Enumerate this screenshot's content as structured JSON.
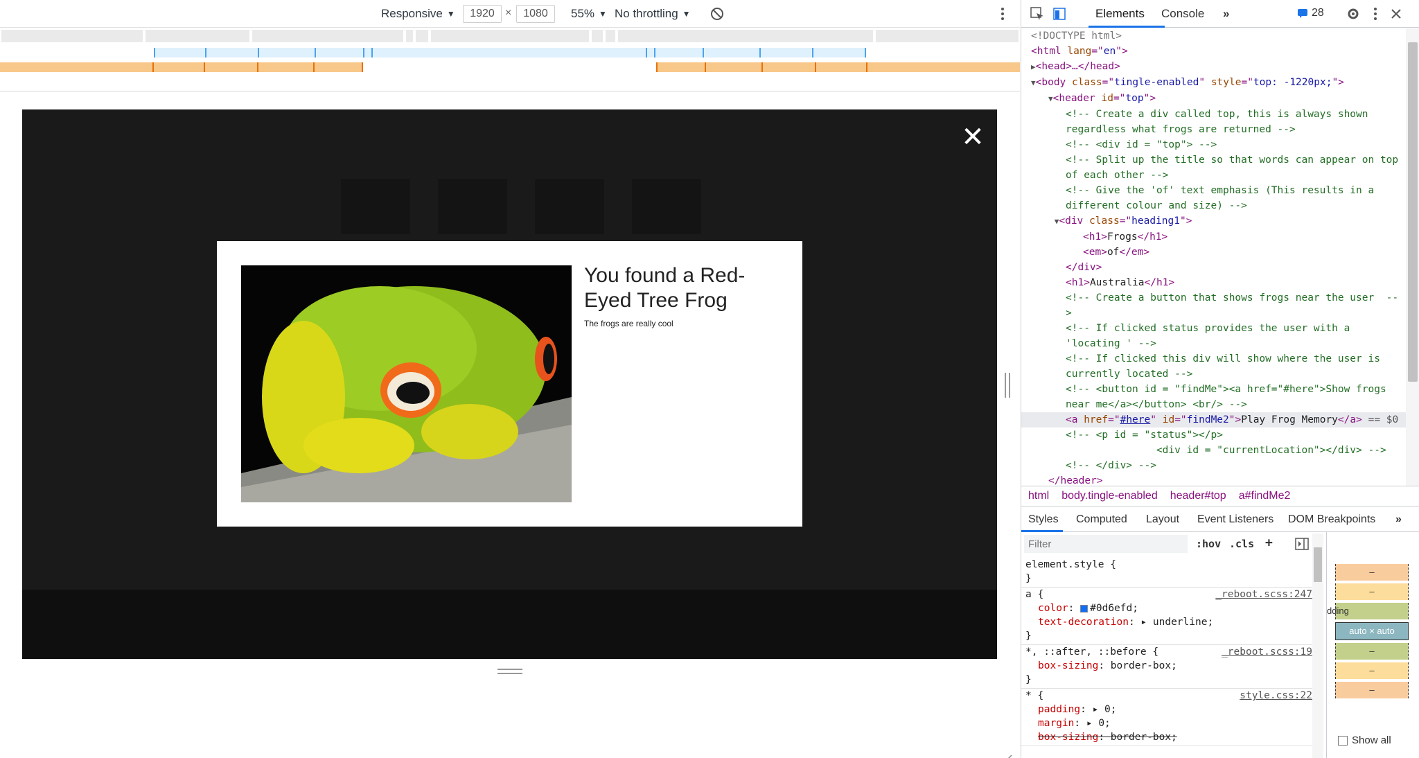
{
  "device_toolbar": {
    "device": "Responsive",
    "width": "1920",
    "height": "1080",
    "times": "×",
    "zoom": "55%",
    "throttling": "No throttling"
  },
  "page": {
    "close_symbol": "✕",
    "modal_title": "You found a Red-Eyed Tree Frog",
    "modal_subtitle": "The frogs are really cool"
  },
  "devtools": {
    "tabs": [
      "Elements",
      "Console"
    ],
    "more_tabs": "»",
    "issues_count": "28",
    "dom_lines": [
      {
        "indent": 0,
        "html": "<span class='cm' style='color:#777'>&lt;!DOCTYPE html&gt;</span>"
      },
      {
        "indent": 0,
        "html": "&lt;<span class='tg'>html</span> <span class='an'>lang</span>=\"<span class='av'>en</span>\"&gt;"
      },
      {
        "indent": 0,
        "html": "<span class='tri'>▶</span>&lt;<span class='tg'>head</span>&gt;…&lt;/<span class='tg'>head</span>&gt;"
      },
      {
        "indent": 0,
        "html": "<span class='tri'>▼</span>&lt;<span class='tg'>body</span> <span class='an'>class</span>=\"<span class='av'>tingle-enabled</span>\" <span class='an'>style</span>=\"<span class='av'>top: -1220px;</span>\"&gt;"
      },
      {
        "indent": 1,
        "html": "<span class='tri'>▼</span>&lt;<span class='tg'>header</span> <span class='an'>id</span>=\"<span class='av'>top</span>\"&gt;"
      },
      {
        "indent": 2,
        "html": "<span class='cm'>&lt;!-- Create a div called top, this is always shown</span>"
      },
      {
        "indent": 2,
        "html": "<span class='cm'>regardless what frogs are returned --&gt;</span>"
      },
      {
        "indent": 2,
        "html": "<span class='cm'>&lt;!-- &lt;div id = \"top\"&gt; --&gt;</span>"
      },
      {
        "indent": 2,
        "html": "<span class='cm'>&lt;!-- Split up the title so that words can appear on top</span>"
      },
      {
        "indent": 2,
        "html": "<span class='cm'>of each other --&gt;</span>"
      },
      {
        "indent": 2,
        "html": "<span class='cm'>&lt;!-- Give the 'of' text emphasis (This results in a</span>"
      },
      {
        "indent": 2,
        "html": "<span class='cm'>different colour and size) --&gt;</span>"
      },
      {
        "indent": 1,
        "html": " <span class='tri'>▼</span>&lt;<span class='tg'>div</span> <span class='an'>class</span>=\"<span class='av'>heading1</span>\"&gt;"
      },
      {
        "indent": 3,
        "html": "&lt;<span class='tg'>h1</span>&gt;<span class='tx'>Frogs</span>&lt;/<span class='tg'>h1</span>&gt;"
      },
      {
        "indent": 3,
        "html": "&lt;<span class='tg'>em</span>&gt;<span class='tx'>of</span>&lt;/<span class='tg'>em</span>&gt;"
      },
      {
        "indent": 2,
        "html": "&lt;/<span class='tg'>div</span>&gt;"
      },
      {
        "indent": 2,
        "html": "&lt;<span class='tg'>h1</span>&gt;<span class='tx'>Australia</span>&lt;/<span class='tg'>h1</span>&gt;"
      },
      {
        "indent": 2,
        "html": "<span class='cm'>&lt;!-- Create a button that shows frogs near the user  --</span>"
      },
      {
        "indent": 2,
        "html": "<span class='cm'>&gt;</span>"
      },
      {
        "indent": 2,
        "html": "<span class='cm'>&lt;!-- If clicked status provides the user with a</span>"
      },
      {
        "indent": 2,
        "html": "<span class='cm'>'locating ' --&gt;</span>"
      },
      {
        "indent": 2,
        "html": "<span class='cm'>&lt;!-- If clicked this div will show where the user is</span>"
      },
      {
        "indent": 2,
        "html": "<span class='cm'>currently located --&gt;</span>"
      },
      {
        "indent": 2,
        "html": "<span class='cm'>&lt;!-- &lt;button id = \"findMe\"&gt;&lt;a href=\"#here\"&gt;Show frogs</span>"
      },
      {
        "indent": 2,
        "html": "<span class='cm'>near me&lt;/a&gt;&lt;/button&gt; &lt;br/&gt; --&gt;</span>"
      },
      {
        "indent": 2,
        "sel": true,
        "html": "&lt;<span class='tg'>a</span> <span class='an'>href</span>=\"<span class='av' style='text-decoration:underline'>#here</span>\" <span class='an'>id</span>=\"<span class='av'>findMe2</span>\"&gt;<span class='tx'>Play Frog Memory</span>&lt;/<span class='tg'>a</span>&gt; <span style='color:#555'>== $0</span>"
      },
      {
        "indent": 2,
        "html": "<span class='cm'>&lt;!-- &lt;p id = \"status\"&gt;&lt;/p&gt;</span>"
      },
      {
        "indent": 2,
        "html": "<span class='cm'>               &lt;div id = \"currentLocation\"&gt;&lt;/div&gt; --&gt;</span>"
      },
      {
        "indent": 2,
        "html": "<span class='cm'>&lt;!-- &lt;/div&gt; --&gt;</span>"
      },
      {
        "indent": 1,
        "html": "&lt;/<span class='tg'>header</span>&gt;"
      }
    ],
    "breadcrumbs": [
      "html",
      "body.tingle-enabled",
      "header#top",
      "a#findMe2"
    ],
    "style_tabs": [
      "Styles",
      "Computed",
      "Layout",
      "Event Listeners",
      "DOM Breakpoints"
    ],
    "style_more": "»",
    "filter_placeholder": "Filter",
    "hov": ":hov",
    "cls": ".cls",
    "plus": "+",
    "rules": [
      {
        "selector": "element.style {",
        "source": "",
        "props": [],
        "close": "}"
      },
      {
        "selector": "a {",
        "source": "_reboot.scss:247",
        "props": [
          {
            "name": "color",
            "value": "#0d6efd;",
            "swatch": true
          },
          {
            "name": "text-decoration",
            "value": "▸ underline;"
          }
        ],
        "close": "}"
      },
      {
        "selector": "*, ::after, ::before {",
        "source": "_reboot.scss:19",
        "props": [
          {
            "name": "box-sizing",
            "value": "border-box;"
          }
        ],
        "close": "}"
      },
      {
        "selector": "* {",
        "source": "style.css:22",
        "props": [
          {
            "name": "padding",
            "value": "▸ 0;"
          },
          {
            "name": "margin",
            "value": "▸ 0;"
          },
          {
            "name": "box-sizing",
            "value": "border-box;",
            "strike": true
          }
        ],
        "close": ""
      }
    ],
    "box_model": {
      "padding_label": "dding",
      "dash": "–",
      "content": "auto × auto",
      "show_all": "Show all"
    }
  }
}
